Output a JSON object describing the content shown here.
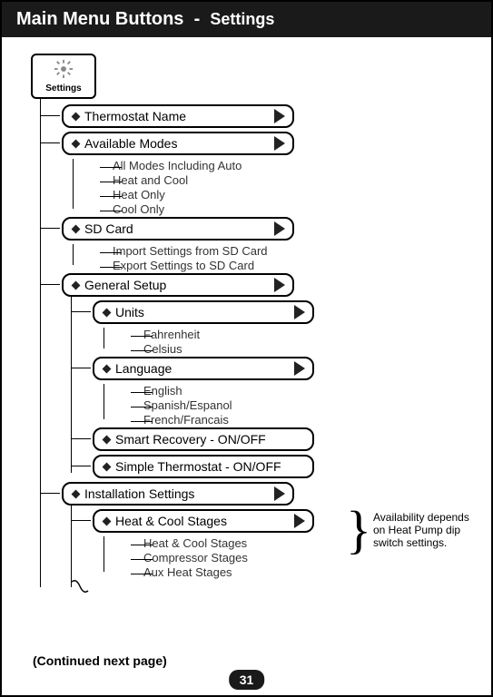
{
  "header": {
    "title": "Main Menu Buttons",
    "sep": "-",
    "subtitle": "Settings"
  },
  "root": {
    "label": "Settings"
  },
  "menu": {
    "thermostat_name": "Thermostat Name",
    "available_modes": {
      "label": "Available Modes",
      "items": [
        "All Modes Including Auto",
        "Heat and Cool",
        "Heat Only",
        "Cool Only"
      ]
    },
    "sd_card": {
      "label": "SD Card",
      "items": [
        "Import Settings from SD Card",
        "Export Settings to SD Card"
      ]
    },
    "general_setup": {
      "label": "General Setup",
      "units": {
        "label": "Units",
        "items": [
          "Fahrenheit",
          "Celsius"
        ]
      },
      "language": {
        "label": "Language",
        "items": [
          "English",
          "Spanish/Espanol",
          "French/Francais"
        ]
      },
      "smart_recovery": "Smart Recovery - ON/OFF",
      "simple_thermostat": "Simple Thermostat - ON/OFF"
    },
    "installation_settings": {
      "label": "Installation Settings",
      "heat_cool_stages": {
        "label": "Heat & Cool Stages",
        "items": [
          "Heat & Cool Stages",
          "Compressor Stages",
          "Aux Heat Stages"
        ]
      }
    }
  },
  "note": "Availability depends on Heat Pump dip switch settings.",
  "continued": "(Continued next page)",
  "page": "31"
}
